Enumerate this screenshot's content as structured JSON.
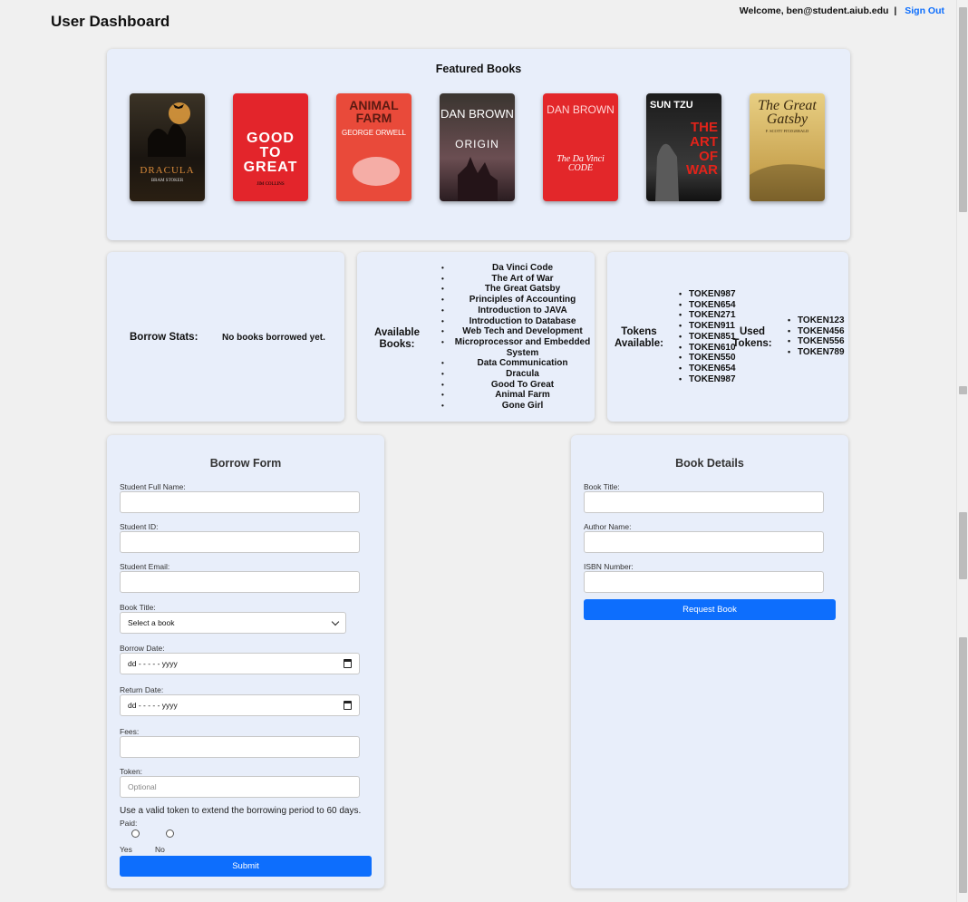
{
  "header": {
    "title": "User Dashboard",
    "welcome": "Welcome, ben@student.aiub.edu",
    "separator": "|",
    "signout": "Sign Out"
  },
  "featured": {
    "title": "Featured Books",
    "books": [
      {
        "title": "DRACULA",
        "author": "BRAM STOKER"
      },
      {
        "title": "GOOD TO GREAT",
        "author": "JIM COLLINS"
      },
      {
        "title": "ANIMAL FARM",
        "author": "GEORGE ORWELL"
      },
      {
        "title": "ORIGIN",
        "author": "DAN BROWN"
      },
      {
        "title": "The Da Vinci CODE",
        "author": "DAN BROWN"
      },
      {
        "title": "THE ART OF WAR",
        "author": "SUN TZU"
      },
      {
        "title": "The Great Gatsby",
        "author": "F. SCOTT FITZGERALD"
      }
    ]
  },
  "stats": {
    "borrow_label": "Borrow Stats:",
    "borrow_value": "No books borrowed yet.",
    "available_label": "Available Books:",
    "available_books": [
      "Da Vinci Code",
      "The Art of War",
      "The Great Gatsby",
      "Principles of Accounting",
      "Introduction to JAVA",
      "Introduction to Database",
      "Web Tech and Development",
      "Microprocessor and Embedded System",
      "Data Communication",
      "Dracula",
      "Good To Great",
      "Animal Farm",
      "Gone Girl"
    ],
    "tokens_label": "Tokens Available:",
    "tokens": [
      "TOKEN987",
      "TOKEN654",
      "TOKEN271",
      "TOKEN911",
      "TOKEN851",
      "TOKEN610",
      "TOKEN550",
      "TOKEN654",
      "TOKEN987"
    ],
    "used_label": "Used Tokens:",
    "used_tokens": [
      "TOKEN123",
      "TOKEN456",
      "TOKEN556",
      "TOKEN789"
    ]
  },
  "borrow_form": {
    "title": "Borrow Form",
    "name_label": "Student Full Name:",
    "id_label": "Student ID:",
    "email_label": "Student Email:",
    "book_label": "Book Title:",
    "book_selected": "Select a book",
    "borrow_date_label": "Borrow Date:",
    "date_placeholder": "dd - - - - - yyyy",
    "return_date_label": "Return Date:",
    "fees_label": "Fees:",
    "token_label": "Token:",
    "token_placeholder": "Optional",
    "note": "Use a valid token to extend the borrowing period to 60 days.",
    "paid_label": "Paid:",
    "yes": "Yes",
    "no": "No",
    "submit": "Submit"
  },
  "details_form": {
    "title": "Book Details",
    "book_title_label": "Book Title:",
    "author_label": "Author Name:",
    "isbn_label": "ISBN Number:",
    "request": "Request Book"
  },
  "colors": {
    "accent": "#0d6efd",
    "card": "#e8eefa",
    "page": "#f0f0f0"
  }
}
